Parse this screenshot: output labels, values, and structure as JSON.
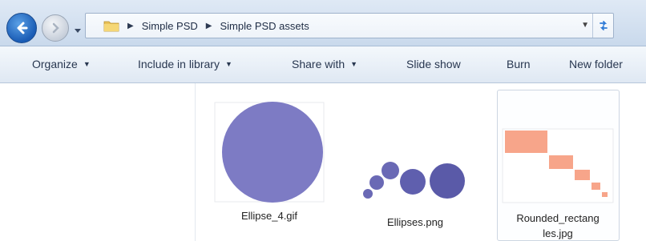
{
  "address_bar": {
    "crumbs": [
      "Simple PSD",
      "Simple PSD assets"
    ],
    "refresh_icon": "refresh-icon"
  },
  "toolbar": {
    "organize": "Organize",
    "include_in_library": "Include in library",
    "share_with": "Share with",
    "slide_show": "Slide show",
    "burn": "Burn",
    "new_folder": "New folder"
  },
  "files": [
    {
      "name": "Ellipse_4.gif"
    },
    {
      "name": "Ellipses.png"
    },
    {
      "name": "Rounded_rectangles.jpg",
      "name_line1": "Rounded_rectang",
      "name_line2": "les.jpg"
    }
  ],
  "colors": {
    "accent_blue": "#1a5cb5",
    "ellipse_fill": "#7d7bc4",
    "ellipses_fill": "#5f5fae",
    "rect_fill": "#f7a58a"
  }
}
